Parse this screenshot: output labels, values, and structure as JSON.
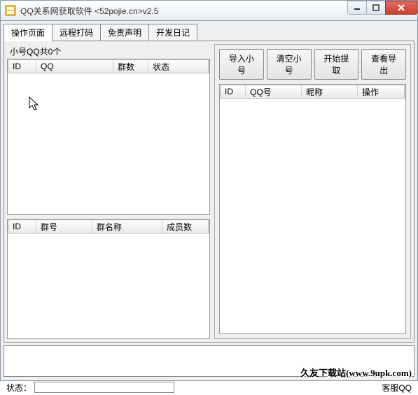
{
  "window": {
    "title": "QQ关系网获取软件 <52pojie.cn>v2.5"
  },
  "tabs": {
    "t0": "操作页面",
    "t1": "远程打码",
    "t2": "免责声明",
    "t3": "开发日记"
  },
  "leftTop": {
    "caption": "小号QQ共0个",
    "cols": {
      "c0": "ID",
      "c1": "QQ",
      "c2": "群数",
      "c3": "状态"
    }
  },
  "leftBottom": {
    "cols": {
      "c0": "ID",
      "c1": "群号",
      "c2": "群名称",
      "c3": "成员数"
    }
  },
  "buttons": {
    "b0": "导入小号",
    "b1": "清空小号",
    "b2": "开始提取",
    "b3": "查看导出"
  },
  "rightList": {
    "cols": {
      "c0": "ID",
      "c1": "QQ号",
      "c2": "昵称",
      "c3": "操作"
    }
  },
  "status": {
    "label": "状态：",
    "value": "",
    "kf_label": "客服QQ"
  },
  "watermark": "久友下载站(www.9upk.com)"
}
